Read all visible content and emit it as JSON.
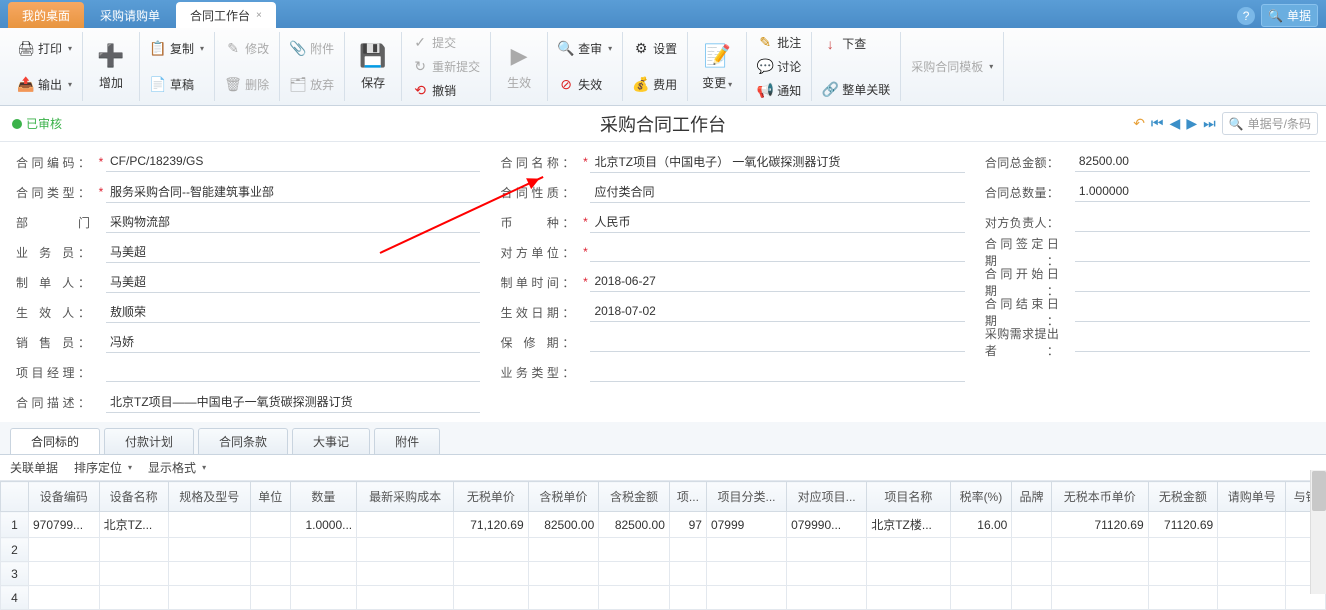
{
  "tabs": {
    "home": "我的桌面",
    "req": "采购请购单",
    "active": "合同工作台"
  },
  "topsearch": "单据",
  "ribbon": {
    "print": "打印",
    "output": "输出",
    "add": "增加",
    "copy": "复制",
    "draft": "草稿",
    "edit": "修改",
    "delete": "删除",
    "attach": "附件",
    "discard": "放弃",
    "save": "保存",
    "submit": "提交",
    "resubmit": "重新提交",
    "undo": "撤销",
    "effect": "生效",
    "review": "查审",
    "invalid": "失效",
    "setting": "设置",
    "fee": "费用",
    "change": "变更",
    "annot": "批注",
    "discuss": "讨论",
    "notify": "通知",
    "down": "下查",
    "relate": "整单关联",
    "tpl": "采购合同模板"
  },
  "status": "已审核",
  "wtitle": "采购合同工作台",
  "navsearch": "单据号/条码",
  "form": {
    "l": [
      {
        "lab": "合同编码：",
        "req": true,
        "val": "CF/PC/18239/GS"
      },
      {
        "lab": "合同类型：",
        "req": true,
        "val": "服务采购合同--智能建筑事业部"
      },
      {
        "lab": "部　　门",
        "req": false,
        "val": "采购物流部"
      },
      {
        "lab": "业 务 员：",
        "req": false,
        "val": "马美超"
      },
      {
        "lab": "制 单 人：",
        "req": false,
        "val": "马美超"
      },
      {
        "lab": "生 效 人：",
        "req": false,
        "val": "敖顺荣"
      },
      {
        "lab": "销 售 员：",
        "req": false,
        "val": "冯娇"
      },
      {
        "lab": "项目经理：",
        "req": false,
        "val": ""
      },
      {
        "lab": "合同描述：",
        "req": false,
        "val": "北京TZ项目——中国电子一氧货碳探测器订货"
      }
    ],
    "m": [
      {
        "lab": "合同名称：",
        "req": true,
        "val": "北京TZ项目（中国电子） 一氧化碳探测器订货"
      },
      {
        "lab": "合同性质：",
        "req": false,
        "val": "应付类合同"
      },
      {
        "lab": "币　　种：",
        "req": true,
        "val": "人民币"
      },
      {
        "lab": "对方单位：",
        "req": true,
        "val": ""
      },
      {
        "lab": "制单时间：",
        "req": true,
        "val": "2018-06-27"
      },
      {
        "lab": "生效日期：",
        "req": false,
        "val": "2018-07-02"
      },
      {
        "lab": "保 修 期：",
        "req": false,
        "val": ""
      },
      {
        "lab": "业务类型：",
        "req": false,
        "val": ""
      }
    ],
    "r": [
      {
        "lab": "合同总金额：",
        "req": false,
        "val": "82500.00"
      },
      {
        "lab": "合同总数量：",
        "req": false,
        "val": "1.000000"
      },
      {
        "lab": "对方负责人：",
        "req": false,
        "val": ""
      },
      {
        "lab": "合同签定日期：",
        "req": false,
        "val": ""
      },
      {
        "lab": "合同开始日期：",
        "req": false,
        "val": ""
      },
      {
        "lab": "合同结束日期：",
        "req": false,
        "val": ""
      },
      {
        "lab": "采购需求提出者：",
        "req": false,
        "val": ""
      }
    ]
  },
  "subtabs": [
    "合同标的",
    "付款计划",
    "合同条款",
    "大事记",
    "附件"
  ],
  "tbar2": {
    "rel": "关联单据",
    "sort": "排序定位",
    "fmt": "显示格式"
  },
  "gridcols": [
    "",
    "设备编码",
    "设备名称",
    "规格及型号",
    "单位",
    "数量",
    "最新采购成本",
    "无税单价",
    "含税单价",
    "含税金额",
    "项...",
    "项目分类...",
    "对应项目...",
    "项目名称",
    "税率(%)",
    "品牌",
    "无税本币单价",
    "无税金额",
    "请购单号",
    "与销"
  ],
  "gridrows": [
    {
      "n": "1",
      "c": [
        "970799...",
        "北京TZ...",
        "",
        "",
        "1.0000...",
        "",
        "71,120.69",
        "82500.00",
        "82500.00",
        "97",
        "07999",
        "079990...",
        "北京TZ楼...",
        "16.00",
        "",
        "71120.69",
        "71120.69",
        "",
        ""
      ]
    },
    {
      "n": "2",
      "c": [
        "",
        "",
        "",
        "",
        "",
        "",
        "",
        "",
        "",
        "",
        "",
        "",
        "",
        "",
        "",
        "",
        "",
        "",
        ""
      ]
    },
    {
      "n": "3",
      "c": [
        "",
        "",
        "",
        "",
        "",
        "",
        "",
        "",
        "",
        "",
        "",
        "",
        "",
        "",
        "",
        "",
        "",
        "",
        ""
      ]
    },
    {
      "n": "4",
      "c": [
        "",
        "",
        "",
        "",
        "",
        "",
        "",
        "",
        "",
        "",
        "",
        "",
        "",
        "",
        "",
        "",
        "",
        "",
        ""
      ]
    }
  ]
}
